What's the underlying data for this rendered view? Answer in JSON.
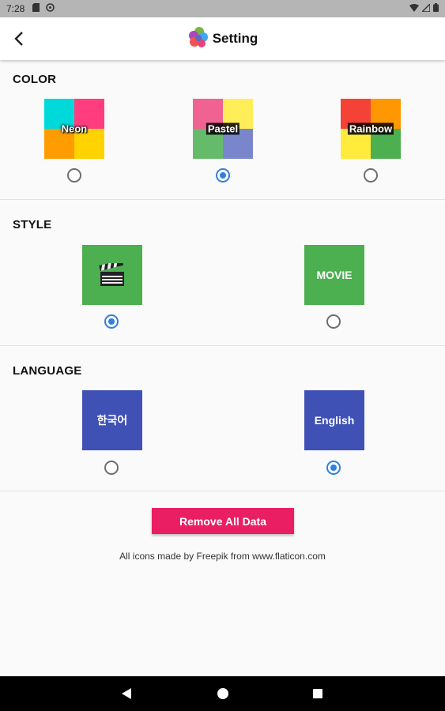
{
  "status_bar": {
    "time": "7:28"
  },
  "header": {
    "title": "Setting"
  },
  "sections": {
    "color": {
      "title": "COLOR",
      "options": [
        {
          "label": "Neon",
          "colors": [
            "#00d9d9",
            "#ff3d7f",
            "#ff9d00",
            "#ffd200"
          ],
          "selected": false
        },
        {
          "label": "Pastel",
          "colors": [
            "#f06292",
            "#ffee58",
            "#66bb6a",
            "#7986cb"
          ],
          "selected": true
        },
        {
          "label": "Rainbow",
          "colors": [
            "#f44336",
            "#ff9800",
            "#ffeb3b",
            "#4caf50"
          ],
          "selected": false
        }
      ]
    },
    "style": {
      "title": "STYLE",
      "options": [
        {
          "icon": "clapperboard-icon",
          "label": "",
          "color": "#4caf50",
          "selected": true
        },
        {
          "icon": "",
          "label": "MOVIE",
          "color": "#4caf50",
          "selected": false
        }
      ]
    },
    "language": {
      "title": "LANGUAGE",
      "options": [
        {
          "label": "한국어",
          "color": "#3f51b5",
          "selected": false
        },
        {
          "label": "English",
          "color": "#3f51b5",
          "selected": true
        }
      ]
    }
  },
  "actions": {
    "remove_label": "Remove All Data"
  },
  "footer": {
    "credit": "All icons made by Freepik from www.flaticon.com"
  },
  "colors": {
    "accent": "#2f80e0",
    "danger": "#e91e63",
    "green": "#4caf50",
    "indigo": "#3f51b5"
  }
}
